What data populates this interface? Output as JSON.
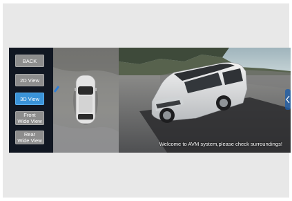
{
  "sidebar": {
    "buttons": [
      {
        "label": "BACK"
      },
      {
        "label": "2D View"
      },
      {
        "label": "3D View",
        "active": true
      },
      {
        "label_line1": "Front",
        "label_line2": "Wide View"
      },
      {
        "label_line1": "Rear",
        "label_line2": "Wide View"
      }
    ]
  },
  "message": "Welcome to AVM system,please check surroundings!",
  "colors": {
    "active_button": "#3a93d8",
    "inactive_button": "#8d8d8d",
    "sidebar_bg": "#111722"
  },
  "icons": {
    "side_handle": "chevron-left-icon",
    "direction_marker": "camera-direction-icon"
  }
}
